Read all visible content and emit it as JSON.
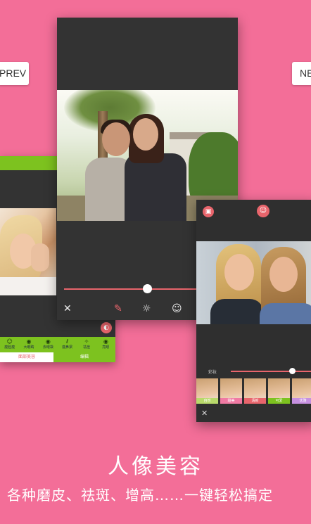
{
  "nav": {
    "prev": "PREV",
    "next": "NE"
  },
  "left_phone": {
    "back_glyph": "↩",
    "tools": [
      {
        "label": "瘦脸瘦",
        "icon": "face-slim-icon"
      },
      {
        "label": "大眼睛",
        "icon": "eye-icon"
      },
      {
        "label": "去眼袋",
        "icon": "eye-bag-icon"
      },
      {
        "label": "瘦鼻梁",
        "icon": "nose-icon"
      },
      {
        "label": "祛痘",
        "icon": "acne-icon"
      },
      {
        "label": "亮眼",
        "icon": "bright-eye-icon"
      }
    ],
    "tab_active": "面部美容",
    "tab_other": "编辑"
  },
  "center_phone": {
    "tools": [
      "close-icon",
      "brush-icon",
      "brightness-icon",
      "face-mask-icon"
    ]
  },
  "right_phone": {
    "slider_label": "彩妆",
    "thumb_labels": [
      "自然",
      "甜美",
      "清新",
      "可爱",
      "优雅"
    ],
    "thumb_colors": [
      "#b8d96b",
      "#f07aa3",
      "#e8656c",
      "#7dc21f",
      "#c690e0"
    ]
  },
  "title": "人像美容",
  "subtitle": "各种磨皮、祛斑、增高……一键轻松搞定"
}
